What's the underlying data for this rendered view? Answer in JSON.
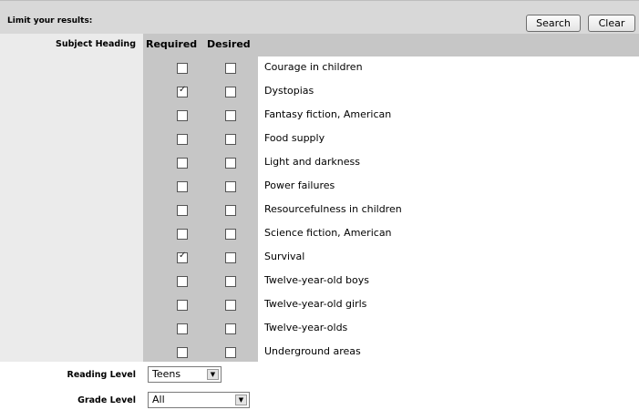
{
  "header": {
    "title": "Limit your results:",
    "search_label": "Search",
    "clear_label": "Clear"
  },
  "columns": {
    "subject_heading": "Subject Heading",
    "required": "Required",
    "desired": "Desired"
  },
  "subjects": [
    {
      "term": "Courage in children",
      "required": false,
      "desired": false
    },
    {
      "term": "Dystopias",
      "required": true,
      "desired": false
    },
    {
      "term": "Fantasy fiction, American",
      "required": false,
      "desired": false
    },
    {
      "term": "Food supply",
      "required": false,
      "desired": false
    },
    {
      "term": "Light and darkness",
      "required": false,
      "desired": false
    },
    {
      "term": "Power failures",
      "required": false,
      "desired": false
    },
    {
      "term": "Resourcefulness in children",
      "required": false,
      "desired": false
    },
    {
      "term": "Science fiction, American",
      "required": false,
      "desired": false
    },
    {
      "term": "Survival",
      "required": true,
      "desired": false
    },
    {
      "term": "Twelve-year-old boys",
      "required": false,
      "desired": false
    },
    {
      "term": "Twelve-year-old girls",
      "required": false,
      "desired": false
    },
    {
      "term": "Twelve-year-olds",
      "required": false,
      "desired": false
    },
    {
      "term": "Underground areas",
      "required": false,
      "desired": false
    }
  ],
  "reading_level": {
    "label": "Reading Level",
    "value": "Teens"
  },
  "grade_level": {
    "label": "Grade Level",
    "value": "All"
  },
  "icons": {
    "dropdown": "chevron-down-icon",
    "checkbox": "checkbox-icon"
  }
}
